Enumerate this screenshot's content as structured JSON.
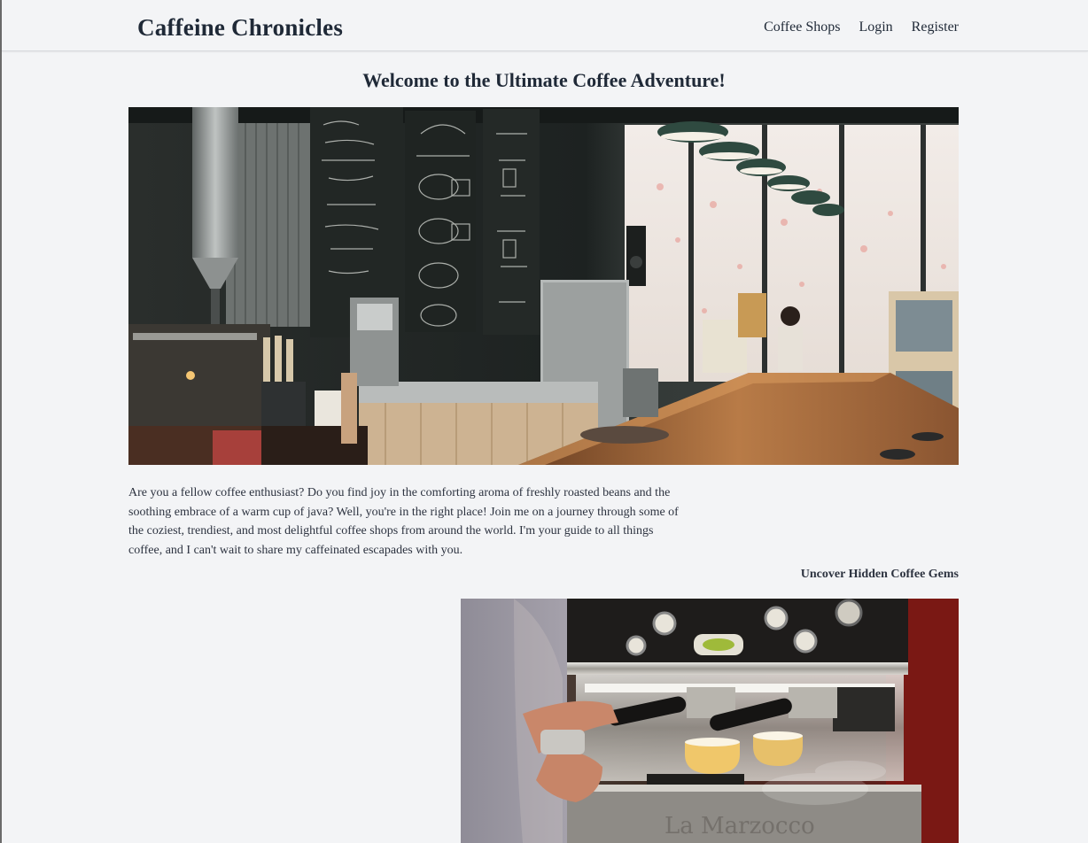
{
  "nav": {
    "brand": "Caffeine Chronicles",
    "links": [
      "Coffee Shops",
      "Login",
      "Register"
    ]
  },
  "main": {
    "title": "Welcome to the Ultimate Coffee Adventure!",
    "intro": "Are you a fellow coffee enthusiast? Do you find joy in the comforting aroma of freshly roasted beans and the soothing embrace of a warm cup of java? Well, you're in the right place! Join me on a journey through some of the coziest, trendiest, and most delightful coffee shops from around the world. I'm your guide to all things coffee, and I can't wait to share my caffeinated escapades with you.",
    "section_heading": "Uncover Hidden Coffee Gems"
  },
  "colors": {
    "background": "#f3f4f6",
    "text": "#1f2937",
    "body_text": "#2d3340"
  }
}
